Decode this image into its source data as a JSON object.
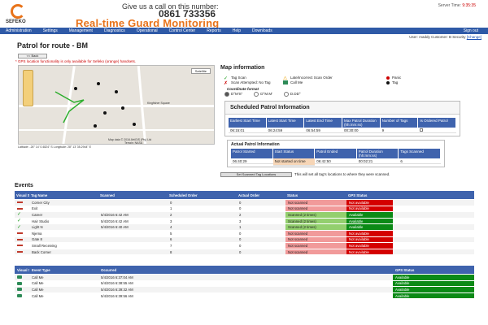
{
  "header": {
    "call_text": "Give us a call on this number:",
    "phone": "0861 733356",
    "brand": "Real-time Guard Monitoring",
    "logo_text": "SEFEKO",
    "server_time_label": "Server Time:",
    "server_time": "9:35:35"
  },
  "nav": [
    "Administration",
    "Settings",
    "Management",
    "Diagnostics",
    "Operational",
    "Control Center",
    "Reports",
    "Help",
    "Downloads"
  ],
  "sign_out": "Sign out",
  "user": {
    "text": "User: maddy  Customer: B Security",
    "change": "[Change]"
  },
  "page_title": "Patrol for route -  BM",
  "back_label": "<< Back",
  "warning": "* GPS location functionality is only available for Sefeko (orange) handsets.",
  "map": {
    "satellite": "Satellite",
    "copyright": "Map data © 2016 AfriGIS (Pty) Ltd",
    "terrain": "Terrain: NASA",
    "place": "Kingfisher Square",
    "latlng": "Latitude: -26° 14' 0.4824'' S Longitude: 28° 13' 35.2944'' E"
  },
  "map_info": {
    "title": "Map information",
    "legend": [
      {
        "label": "Tag Scan",
        "icon": "check-icon"
      },
      {
        "label": "Late/Incorrect Scan Order",
        "icon": "warning-icon"
      },
      {
        "label": "Panic",
        "icon": "panic-icon"
      },
      {
        "label": "Scan Attempted: No Tag",
        "icon": "x-icon"
      },
      {
        "label": "Call Me",
        "icon": "phone-icon"
      },
      {
        "label": "Tag",
        "icon": "dot-icon"
      }
    ],
    "coord_format": "Coordinate format",
    "formats": [
      "D°M'S\"",
      "D°M.M'",
      "D.DD°"
    ]
  },
  "scheduled": {
    "title": "Scheduled Patrol Information",
    "headers": [
      "Earliest Start Time",
      "Latest Start Time",
      "Latest End Time",
      "Max Patrol Duration (hh:mm:ss)",
      "Number of Tags",
      "Is Ordered Patrol"
    ],
    "row": [
      "06:15:01",
      "06:24:59",
      "06:54:59",
      "00:30:00",
      "9",
      ""
    ]
  },
  "actual": {
    "title": "Actual Patrol Information",
    "headers": [
      "Patrol Started",
      "Start Status",
      "Patrol Ended",
      "Patrol Duration (hh:mm:ss)",
      "Tags Scanned"
    ],
    "row": [
      "06:40:29",
      "Not started on time",
      "06:42:50",
      "00:02:21",
      "6"
    ]
  },
  "set_button": "Set Scanned Tag Locations",
  "set_note": "This will set all tag's locations to where they were scanned.",
  "events": {
    "title": "Events",
    "headers": [
      "Visual Status",
      "Tag Name",
      "Scanned",
      "Scheduled Order",
      "Actual Order",
      "Status",
      "GPS Status"
    ],
    "rows": [
      {
        "ok": false,
        "name": "Corner City",
        "scanned": "",
        "sched": "0",
        "actual": "0",
        "status": "Not scanned",
        "gps": "Not available"
      },
      {
        "ok": false,
        "name": "Exit",
        "scanned": "",
        "sched": "1",
        "actual": "0",
        "status": "Not scanned",
        "gps": "Not available"
      },
      {
        "ok": true,
        "name": "Career",
        "scanned": "5/4/2016 6:42 AM",
        "sched": "2",
        "actual": "2",
        "status": "Scanned (2 times)",
        "gps": "Available"
      },
      {
        "ok": true,
        "name": "Hair Studio",
        "scanned": "5/4/2016 6:42 AM",
        "sched": "3",
        "actual": "3",
        "status": "Scanned (2 times)",
        "gps": "Available"
      },
      {
        "ok": true,
        "name": "Light N",
        "scanned": "5/4/2016 6:40 AM",
        "sched": "4",
        "actual": "1",
        "status": "Scanned (2 times)",
        "gps": "Available"
      },
      {
        "ok": false,
        "name": "Njema",
        "scanned": "",
        "sched": "5",
        "actual": "0",
        "status": "Not scanned",
        "gps": "Not available"
      },
      {
        "ok": false,
        "name": "Gate 8",
        "scanned": "",
        "sched": "6",
        "actual": "0",
        "status": "Not scanned",
        "gps": "Not available"
      },
      {
        "ok": false,
        "name": "Small Receiving",
        "scanned": "",
        "sched": "7",
        "actual": "0",
        "status": "Not scanned",
        "gps": "Not available"
      },
      {
        "ok": false,
        "name": "Back Corner",
        "scanned": "",
        "sched": "8",
        "actual": "0",
        "status": "Not scanned",
        "gps": "Not available"
      }
    ]
  },
  "calls": {
    "headers": [
      "Visual Status",
      "Event Type",
      "Occurred",
      "",
      "GPS Status"
    ],
    "rows": [
      {
        "type": "Call Me",
        "occurred": "5/4/2016 6:37:04 AM",
        "gps": "Available"
      },
      {
        "type": "Call Me",
        "occurred": "5/4/2016 6:38:55 AM",
        "gps": "Available"
      },
      {
        "type": "Call Me",
        "occurred": "5/4/2016 6:39:32 AM",
        "gps": "Available"
      },
      {
        "type": "Call Me",
        "occurred": "5/4/2016 6:39:56 AM",
        "gps": "Available"
      }
    ]
  },
  "colors": {
    "nav": "#2f5aa7",
    "brand": "#e8731a",
    "bad": "#d40000",
    "good": "#0b8a16"
  }
}
